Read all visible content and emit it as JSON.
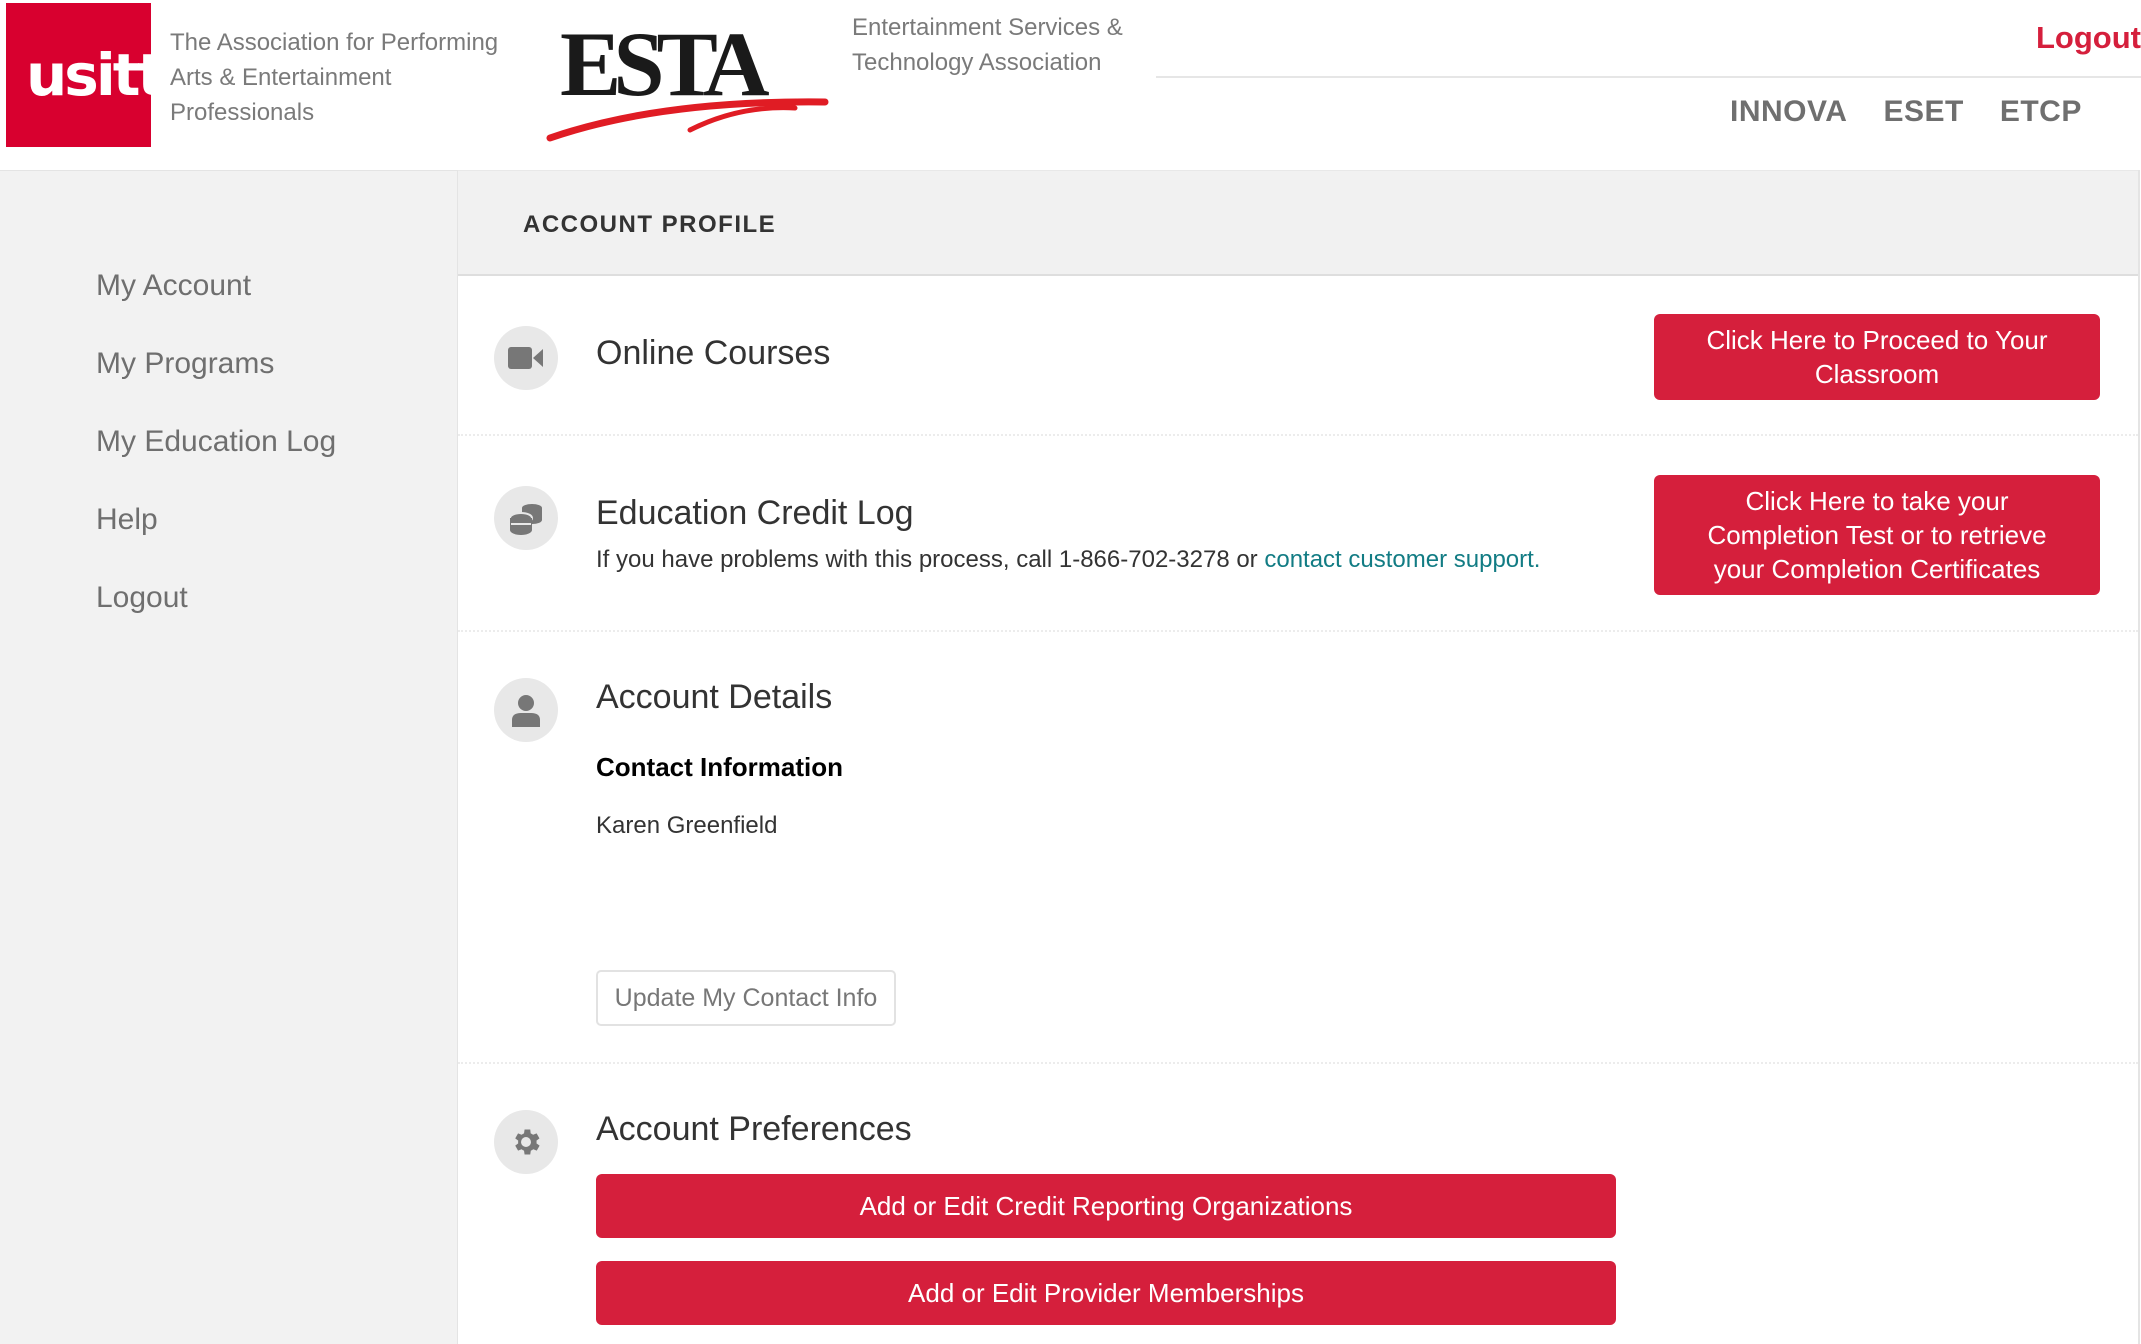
{
  "header": {
    "usitt_logo_text": "usitt",
    "usitt_tagline": "The Association for Performing Arts & Entertainment Professionals",
    "esta_logo_text": "ESTA",
    "esta_tagline": "Entertainment Services & Technology Association",
    "logout_label": "Logout",
    "nav": [
      {
        "label": "INNOVA"
      },
      {
        "label": "ESET"
      },
      {
        "label": "ETCP"
      }
    ]
  },
  "sidebar": {
    "items": [
      {
        "label": "My Account"
      },
      {
        "label": "My Programs"
      },
      {
        "label": "My Education Log"
      },
      {
        "label": "Help"
      },
      {
        "label": "Logout"
      }
    ]
  },
  "main": {
    "title": "ACCOUNT PROFILE",
    "online_courses": {
      "icon": "video-camera-icon",
      "title": "Online Courses",
      "button_label": "Click Here to Proceed to Your Classroom"
    },
    "education_credit_log": {
      "icon": "coins-stack-icon",
      "title": "Education Credit Log",
      "help_text": "If you have problems with this process, call 1-866-702-3278 or ",
      "support_link": "contact customer support.",
      "button_label": "Click Here to take your Completion Test or to retrieve your Completion Certificates"
    },
    "account_details": {
      "icon": "user-icon",
      "title": "Account Details",
      "contact_heading": "Contact Information",
      "contact_name": "Karen Greenfield",
      "update_button_label": "Update My Contact Info"
    },
    "account_preferences": {
      "icon": "gear-icon",
      "title": "Account Preferences",
      "buttons": [
        {
          "label": "Add or Edit Credit Reporting Organizations"
        },
        {
          "label": "Add or Edit Provider Memberships"
        }
      ]
    }
  },
  "colors": {
    "brand_red": "#d51f3c",
    "link_teal": "#127c84",
    "sidebar_bg": "#f2f2f2"
  }
}
